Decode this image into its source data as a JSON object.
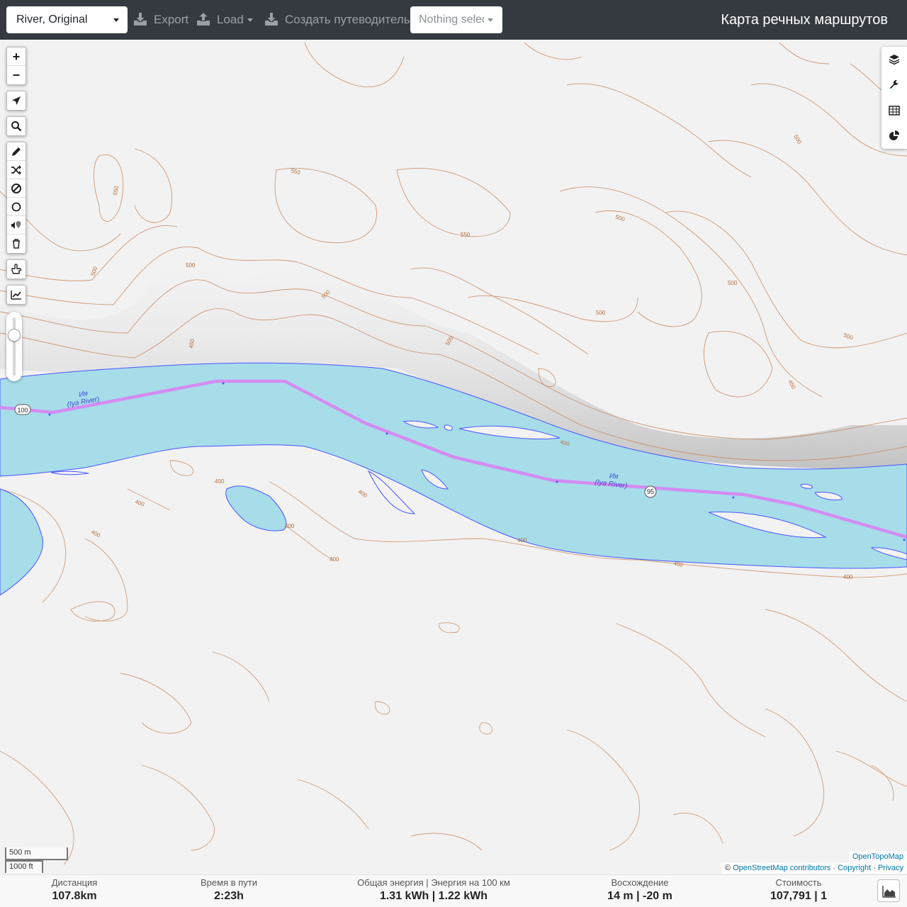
{
  "navbar": {
    "profile_select": "River, Original",
    "export_label": "Export",
    "load_label": "Load",
    "guide_label": "Создать путеводитель",
    "track_select": "Nothing selected",
    "brand": "Карта речных маршрутов"
  },
  "map": {
    "zoom_in": "+",
    "zoom_out": "−",
    "river_label_ru": "Ия",
    "river_label_en": "(Iya River)",
    "marker_1": "100",
    "marker_2": "95",
    "contours": [
      "550",
      "550",
      "550",
      "500",
      "500",
      "500",
      "500",
      "500",
      "500",
      "500",
      "500",
      "500",
      "450",
      "450",
      "400",
      "400",
      "400",
      "400",
      "400",
      "400",
      "400",
      "400",
      "400",
      "400"
    ],
    "scale_m": "500 m",
    "scale_ft": "1000 ft",
    "attribution_tiles": "OpenTopoMap",
    "attribution_prefix": "©",
    "attribution_osm": "OpenStreetMap contributors",
    "attribution_copyright": "Copyright",
    "attribution_privacy": "Privacy",
    "attribution_sep": "·",
    "colors": {
      "water": "#a6dde9",
      "route": "#d58bf2",
      "contour": "#c9875a",
      "water_edge": "#4a55ff"
    }
  },
  "stats": {
    "distance": {
      "title": "Дистанция",
      "value": "107.8",
      "unit": "km"
    },
    "duration": {
      "title": "Время в пути",
      "value": "2:23",
      "unit": "h"
    },
    "energy": {
      "title": "Общая энергия | Энергия на 100 км",
      "value": "1.31 kWh | 1.22 kWh"
    },
    "ascent": {
      "title": "Восхождение",
      "value": "14 m | -20 m"
    },
    "cost": {
      "title": "Стоимость",
      "value": "107,791 | 1"
    }
  }
}
